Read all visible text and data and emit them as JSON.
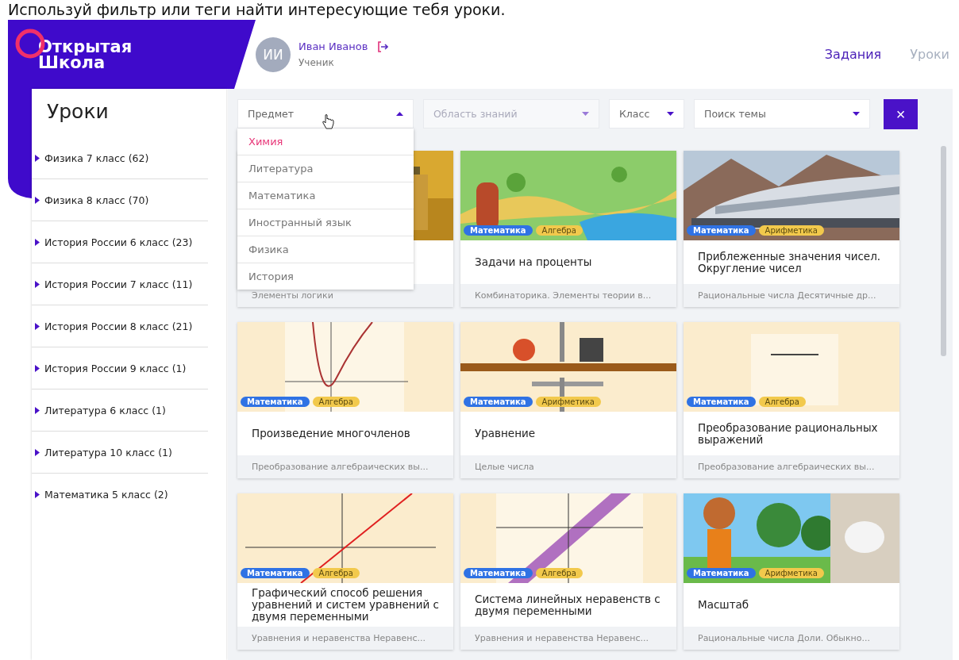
{
  "top_hint": "Используй фильтр или теги найти интересующие тебя уроки.",
  "header": {
    "logo": [
      "Открытая",
      "Школа"
    ],
    "avatar": "ИИ",
    "user_name": "Иван Иванов",
    "user_role": "Ученик",
    "nav": [
      {
        "label": "Задания",
        "selected": true
      },
      {
        "label": "Уроки",
        "selected": false
      }
    ]
  },
  "sidebar": {
    "title": "Уроки",
    "items": [
      {
        "label": "Физика 7 класс (62)"
      },
      {
        "label": "Физика 8 класс (70)"
      },
      {
        "label": "История России 6 класс (23)"
      },
      {
        "label": "История России 7 класс (11)"
      },
      {
        "label": "История России 8 класс (21)"
      },
      {
        "label": "История России 9 класс (1)"
      },
      {
        "label": "Литература 6 класс (1)"
      },
      {
        "label": "Литература 10 класс (1)"
      },
      {
        "label": "Математика 5 класс (2)"
      }
    ]
  },
  "filters": [
    {
      "placeholder": "Предмет",
      "expanded": true,
      "disabled": false,
      "options": [
        {
          "label": "Химия",
          "selected": true
        },
        {
          "label": "Литература",
          "selected": false
        },
        {
          "label": "Математика",
          "selected": false
        },
        {
          "label": "Иностранный язык",
          "selected": false
        },
        {
          "label": "Физика",
          "selected": false
        },
        {
          "label": "История",
          "selected": false
        }
      ]
    },
    {
      "placeholder": "Область знаний",
      "expanded": false,
      "disabled": true
    },
    {
      "placeholder": "Класс",
      "expanded": false,
      "disabled": false
    },
    {
      "placeholder": "Поиск темы",
      "expanded": false,
      "disabled": false
    }
  ],
  "clear_button": "×",
  "covered_card": {
    "kind": "picture",
    "subtitle": "Элементы логики"
  },
  "cards": [
    {
      "kind": "picture",
      "tags": [
        {
          "label": "Математика",
          "color": "#2f72e4"
        },
        {
          "label": "Алгебра",
          "color": "#f2c94c"
        }
      ],
      "title": "Задачи на проценты",
      "subtitle": "Комбинаторика. Элементы теории в..."
    },
    {
      "kind": "picture",
      "tags": [
        {
          "label": "Математика",
          "color": "#2f72e4"
        },
        {
          "label": "Арифметика",
          "color": "#f2c94c"
        }
      ],
      "title": "Приблеженные значения чисел. Округление чисел",
      "subtitle": "Рациональные числа Десятичные др..."
    },
    {
      "kind": "picture",
      "tags": [
        {
          "label": "Математика",
          "color": "#2f72e4"
        },
        {
          "label": "Алгебра",
          "color": "#f2c94c"
        }
      ],
      "title": "Произведение многочленов",
      "subtitle": "Преобразование алгебраических вы..."
    },
    {
      "kind": "picture",
      "tags": [
        {
          "label": "Математика",
          "color": "#2f72e4"
        },
        {
          "label": "Арифметика",
          "color": "#f2c94c"
        }
      ],
      "title": "Уравнение",
      "subtitle": "Целые числа"
    },
    {
      "kind": "picture",
      "tags": [
        {
          "label": "Математика",
          "color": "#2f72e4"
        },
        {
          "label": "Алгебра",
          "color": "#f2c94c"
        }
      ],
      "title": "Преобразование рациональных выражений",
      "subtitle": "Преобразование алгебраических вы..."
    },
    {
      "kind": "picture",
      "tags": [
        {
          "label": "Математика",
          "color": "#2f72e4"
        },
        {
          "label": "Алгебра",
          "color": "#f2c94c"
        }
      ],
      "title": "Графический способ решения уравнений и систем уравнений с двумя переменными",
      "subtitle": "Уравнения и неравенства Неравенс..."
    },
    {
      "kind": "picture",
      "tags": [
        {
          "label": "Математика",
          "color": "#2f72e4"
        },
        {
          "label": "Алгебра",
          "color": "#f2c94c"
        }
      ],
      "title": "Система линейных неравенств с двумя переменными",
      "subtitle": "Уравнения и неравенства Неравенс..."
    },
    {
      "kind": "picture",
      "tags": [
        {
          "label": "Математика",
          "color": "#2f72e4"
        },
        {
          "label": "Арифметика",
          "color": "#f2c94c"
        }
      ],
      "title": "Масштаб",
      "subtitle": "Рациональные числа Доли. Обыкно..."
    }
  ]
}
